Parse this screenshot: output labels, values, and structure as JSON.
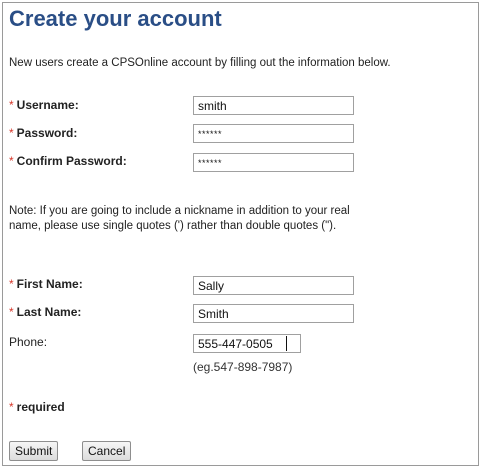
{
  "page": {
    "title": "Create your account",
    "intro": "New users create a CPSOnline account by filling out the information below."
  },
  "form": {
    "required_marker": "*",
    "username_label": "Username:",
    "username_value": "smith",
    "password_label": "Password:",
    "password_value": "******",
    "confirm_label": "Confirm Password:",
    "confirm_value": "******",
    "note": "Note: If you are going to include a nickname in addition to your real name, please use single quotes (') rather than double quotes (\").",
    "first_name_label": "First Name:",
    "first_name_value": "Sally",
    "last_name_label": "Last Name:",
    "last_name_value": "Smith",
    "phone_label": "Phone:",
    "phone_value": "555-447-0505",
    "phone_hint": "(eg.547-898-7987)",
    "required_text": "required",
    "submit_label": "Submit",
    "cancel_label": "Cancel"
  },
  "colors": {
    "title": "#2a4e86",
    "required_marker": "#d6372a"
  }
}
